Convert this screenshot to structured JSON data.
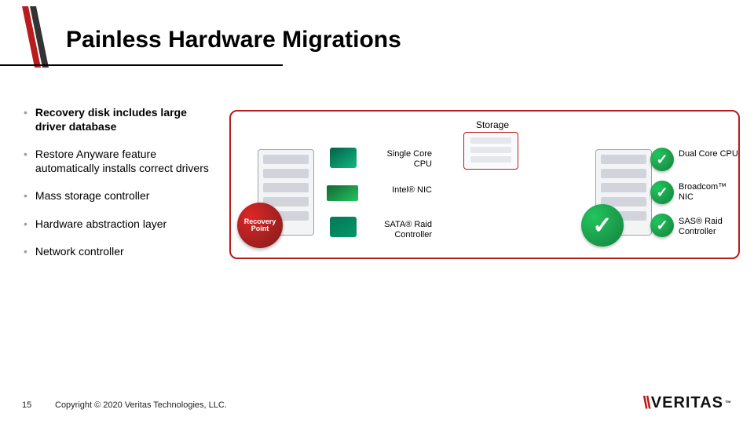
{
  "title": "Painless Hardware Migrations",
  "bullets": [
    "Recovery disk includes large driver database",
    "Restore Anyware feature automatically installs correct drivers",
    "Mass storage controller",
    "Hardware abstraction layer",
    "Network controller"
  ],
  "diagram": {
    "storage_label": "Storage",
    "recovery_badge": "Recovery Point",
    "source": {
      "cpu": "Single Core CPU",
      "nic": "Intel® NIC",
      "raid": "SATA® Raid Controller"
    },
    "target": {
      "cpu": "Dual Core CPU",
      "nic": "Broadcom™ NIC",
      "raid": "SAS® Raid Controller"
    },
    "checkmark": "✓"
  },
  "footer": {
    "page": "15",
    "copyright": "Copyright © 2020 Veritas Technologies, LLC."
  },
  "brand": {
    "name": "VERITAS",
    "tm": "™"
  },
  "colors": {
    "accent": "#b91c1c",
    "success": "#16a34a"
  }
}
